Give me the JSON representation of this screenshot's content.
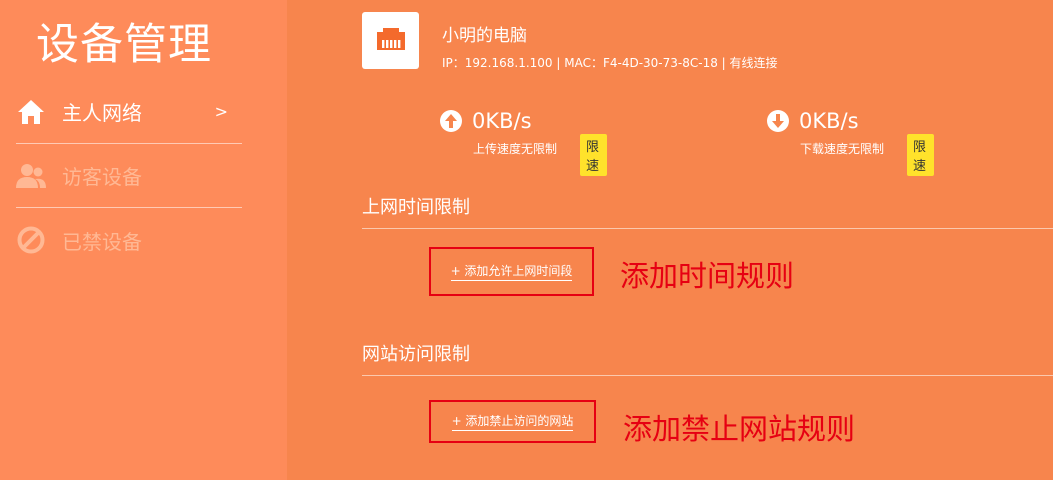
{
  "sidebar": {
    "title": "设备管理",
    "items": [
      {
        "label": "主人网络",
        "icon": "home-icon",
        "active": true,
        "chevron": ">"
      },
      {
        "label": "访客设备",
        "icon": "users-icon",
        "active": false
      },
      {
        "label": "已禁设备",
        "icon": "ban-icon",
        "active": false
      }
    ]
  },
  "device": {
    "name": "小明的电脑",
    "icon": "ethernet-port-icon",
    "info": "IP：192.168.1.100 | MAC：F4-4D-30-73-8C-18 | 有线连接"
  },
  "upload": {
    "value": "0KB/s",
    "caption": "上传速度无限制",
    "button": "限 速",
    "icon": "arrow-up-icon"
  },
  "download": {
    "value": "0KB/s",
    "caption": "下载速度无限制",
    "button": "限 速",
    "icon": "arrow-down-icon"
  },
  "time_limit": {
    "title": "上网时间限制",
    "link": "+ 添加允许上网时间段",
    "annotation": "添加时间规则"
  },
  "site_limit": {
    "title": "网站访问限制",
    "link": "+ 添加禁止访问的网站",
    "annotation": "添加禁止网站规则"
  },
  "colors": {
    "sidebar_bg": "#fe8b5a",
    "main_bg": "#f7854d",
    "accent_yellow": "#ffe22b",
    "annotation_red": "#e60012"
  }
}
